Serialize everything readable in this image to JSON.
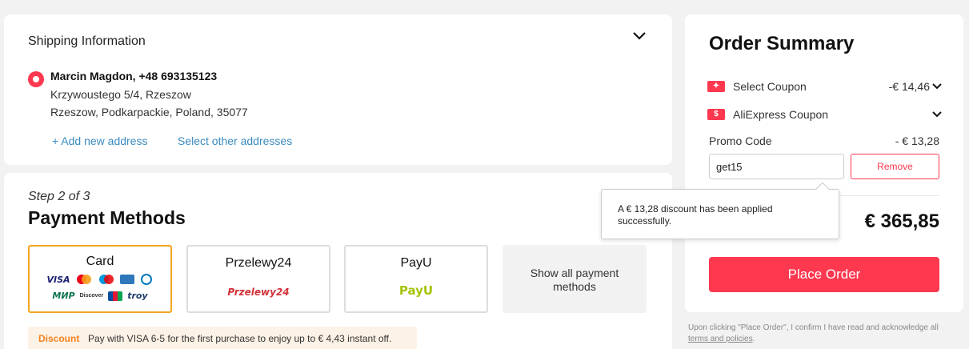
{
  "shipping": {
    "title": "Shipping Information",
    "name": "Marcin Magdon, +48 693135123",
    "address_line1": "Krzywoustego 5/4, Rzeszow",
    "address_line2": "Rzeszow, Podkarpackie, Poland, 35077",
    "add_new": "+ Add new address",
    "select_other": "Select other addresses"
  },
  "payment": {
    "step": "Step 2 of 3",
    "title": "Payment Methods",
    "methods": [
      {
        "label": "Card",
        "logos_row1": [
          "VISA",
          "Mastercard",
          "Maestro",
          "Amex",
          "Diners"
        ],
        "logos_row2": [
          "МИР",
          "Discover",
          "JCB",
          "troy"
        ]
      },
      {
        "label": "Przelewy24",
        "logo": "Przelewy24"
      },
      {
        "label": "PayU",
        "logo": "PayU"
      },
      {
        "label": "Show all payment methods"
      }
    ],
    "discount_tag": "Discount",
    "discount_text": "Pay with VISA 6-5 for the first purchase to enjoy up to € 4,43 instant off."
  },
  "summary": {
    "title": "Order Summary",
    "select_coupon_label": "Select Coupon",
    "select_coupon_value": "-€ 14,46",
    "ali_coupon_label": "AliExpress Coupon",
    "promo_label": "Promo Code",
    "promo_value": "- € 13,28",
    "promo_input": "get15",
    "remove_label": "Remove",
    "total": "€ 365,85",
    "place_order": "Place Order"
  },
  "tooltip": {
    "text": "A € 13,28 discount has been applied successfully."
  },
  "footer": {
    "notice": "Upon clicking \"Place Order\", I confirm I have read and acknowledge all",
    "terms_link": "terms and policies",
    "terms_suffix": "."
  },
  "colors": {
    "accent": "#fd384f",
    "selected_border": "#f5a623",
    "link": "#3a8bbf",
    "discount": "#f58220"
  }
}
